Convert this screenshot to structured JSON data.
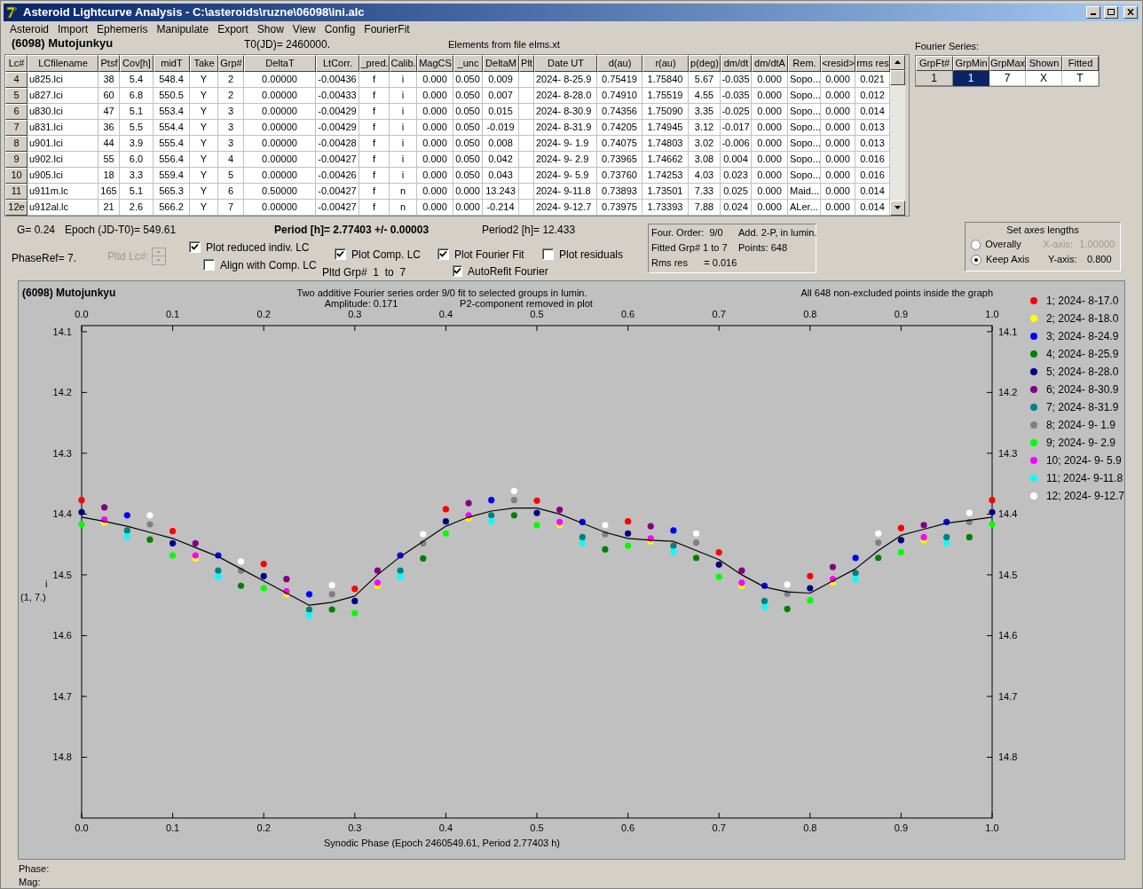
{
  "window": {
    "title": "Asteroid Lightcurve Analysis - C:\\asteroids\\ruzne\\06098\\ini.alc"
  },
  "menu": [
    "Asteroid",
    "Import",
    "Ephemeris",
    "Manipulate",
    "Export",
    "Show",
    "View",
    "Config",
    "FourierFit"
  ],
  "header": {
    "asteroid": "(6098) Mutojunkyu",
    "t0": "T0(JD)= 2460000.",
    "elements": "Elements from file elms.xt"
  },
  "table": {
    "columns": [
      "Lc#",
      "LCfilename",
      "Ptsf",
      "Cov[h]",
      "midT",
      "Take",
      "Grp#",
      "DeltaT",
      "LtCorr.",
      "_pred.",
      "Calib.",
      "MagCS",
      "_unc",
      "DeltaM",
      "Plt",
      "Date UT",
      "d(au)",
      "r(au)",
      "p(deg)",
      "dm/dt",
      "dm/dtA",
      "Rem.",
      "<resid>",
      "rms res"
    ],
    "rows": [
      {
        "cells": [
          "4",
          "u825.lci",
          "38",
          "5.4",
          "548.4",
          "Y",
          "2",
          "0.00000",
          "-0.00436",
          "f",
          "i",
          "0.000",
          "0.050",
          "0.009",
          "",
          "2024- 8-25.9",
          "0.75419",
          "1.75840",
          "5.67",
          "-0.035",
          "0.000",
          "Sopo...",
          "0.000",
          "0.021"
        ]
      },
      {
        "cells": [
          "5",
          "u827.lci",
          "60",
          "6.8",
          "550.5",
          "Y",
          "2",
          "0.00000",
          "-0.00433",
          "f",
          "i",
          "0.000",
          "0.050",
          "0.007",
          "",
          "2024- 8-28.0",
          "0.74910",
          "1.75519",
          "4.55",
          "-0.035",
          "0.000",
          "Sopo...",
          "0.000",
          "0.012"
        ]
      },
      {
        "cells": [
          "6",
          "u830.lci",
          "47",
          "5.1",
          "553.4",
          "Y",
          "3",
          "0.00000",
          "-0.00429",
          "f",
          "i",
          "0.000",
          "0.050",
          "0.015",
          "",
          "2024- 8-30.9",
          "0.74356",
          "1.75090",
          "3.35",
          "-0.025",
          "0.000",
          "Sopo...",
          "0.000",
          "0.014"
        ]
      },
      {
        "cells": [
          "7",
          "u831.lci",
          "36",
          "5.5",
          "554.4",
          "Y",
          "3",
          "0.00000",
          "-0.00429",
          "f",
          "i",
          "0.000",
          "0.050",
          "-0.019",
          "",
          "2024- 8-31.9",
          "0.74205",
          "1.74945",
          "3.12",
          "-0.017",
          "0.000",
          "Sopo...",
          "0.000",
          "0.013"
        ]
      },
      {
        "cells": [
          "8",
          "u901.lci",
          "44",
          "3.9",
          "555.4",
          "Y",
          "3",
          "0.00000",
          "-0.00428",
          "f",
          "i",
          "0.000",
          "0.050",
          "0.008",
          "",
          "2024- 9- 1.9",
          "0.74075",
          "1.74803",
          "3.02",
          "-0.006",
          "0.000",
          "Sopo...",
          "0.000",
          "0.013"
        ]
      },
      {
        "cells": [
          "9",
          "u902.lci",
          "55",
          "6.0",
          "556.4",
          "Y",
          "4",
          "0.00000",
          "-0.00427",
          "f",
          "i",
          "0.000",
          "0.050",
          "0.042",
          "",
          "2024- 9- 2.9",
          "0.73965",
          "1.74662",
          "3.08",
          "0.004",
          "0.000",
          "Sopo...",
          "0.000",
          "0.016"
        ]
      },
      {
        "cells": [
          "10",
          "u905.lci",
          "18",
          "3.3",
          "559.4",
          "Y",
          "5",
          "0.00000",
          "-0.00426",
          "f",
          "i",
          "0.000",
          "0.050",
          "0.043",
          "",
          "2024- 9- 5.9",
          "0.73760",
          "1.74253",
          "4.03",
          "0.023",
          "0.000",
          "Sopo...",
          "0.000",
          "0.016"
        ]
      },
      {
        "cells": [
          "11",
          "u911m.lc",
          "165",
          "5.1",
          "565.3",
          "Y",
          "6",
          "0.50000",
          "-0.00427",
          "f",
          "n",
          "0.000",
          "0.000",
          "13.243",
          "",
          "2024- 9-11.8",
          "0.73893",
          "1.73501",
          "7.33",
          "0.025",
          "0.000",
          "Maid...",
          "0.000",
          "0.014"
        ]
      },
      {
        "cells": [
          "12e",
          "u912al.lc",
          "21",
          "2.6",
          "566.2",
          "Y",
          "7",
          "0.00000",
          "-0.00427",
          "f",
          "n",
          "0.000",
          "0.000",
          "-0.214",
          "",
          "2024- 9-12.7",
          "0.73975",
          "1.73393",
          "7.88",
          "0.024",
          "0.000",
          "ALer...",
          "0.000",
          "0.014"
        ]
      }
    ]
  },
  "fourier": {
    "label": "Fourier Series:",
    "columns": [
      "GrpFt#",
      "GrpMin",
      "GrpMax",
      "Shown",
      "Fitted"
    ],
    "rows": [
      {
        "cells": [
          {
            "text": "1",
            "selected": false
          },
          {
            "text": "1",
            "selected": true
          },
          {
            "text": "7",
            "selected": false
          },
          {
            "text": "X",
            "selected": false
          },
          {
            "text": "T",
            "selected": false
          }
        ]
      }
    ]
  },
  "info": {
    "g": "G= 0.24",
    "epoch": "Epoch (JD-T0)= 549.61",
    "period": "Period [h]= 2.77403 +/- 0.00003",
    "period2": "Period2 [h]= 12.433",
    "phase_ref": "PhaseRef= 7.",
    "pltd_grp": "Pltd Grp#  1  to  7"
  },
  "spinner": {
    "label": "Pltd Lc#:",
    "disabled": true
  },
  "checkboxes": [
    {
      "label": "Plot reduced indiv. LC",
      "checked": true
    },
    {
      "label": "Align with Comp. LC",
      "checked": false
    },
    {
      "label": "Plot Comp. LC",
      "checked": true
    },
    {
      "label": "Plot Fourier Fit",
      "checked": true
    },
    {
      "label": "AutoRefit Fourier",
      "checked": true
    },
    {
      "label": "Plot residuals",
      "checked": false
    }
  ],
  "fit_box": [
    "Four. Order:  9/0",
    "Add. 2-P, in lumin.",
    "Fitted Grp# 1 to 7",
    "Points: 648",
    "Rms res      = 0.016"
  ],
  "axes": {
    "title": "Set axes lengths",
    "options": [
      {
        "label": "Overally",
        "selected": false
      },
      {
        "label": "Keep Axis",
        "selected": true
      }
    ],
    "fields": [
      {
        "label": "X-axis:",
        "value": "1.00000",
        "disabled": true
      },
      {
        "label": "Y-axis:",
        "value": "0.800",
        "disabled": false
      }
    ]
  },
  "plot": {
    "texts": {
      "title": "(6098) Mutojunkyu",
      "line1": "Two additive Fourier series order 9/0 fit to selected groups in lumin.",
      "amplitude": "Amplitude: 0.171",
      "p2": "P2-component removed in plot",
      "points": "All 648 non-excluded points inside the graph",
      "ylabel2": "(1, 7.)"
    },
    "chart_data": {
      "type": "scatter",
      "xlabel": "Synodic Phase (Epoch 2460549.61, Period 2.77403 h)",
      "ylabel": "i",
      "x": [
        0,
        0.025,
        0.05,
        0.075,
        0.1,
        0.125,
        0.15,
        0.175,
        0.2,
        0.225,
        0.25,
        0.275,
        0.3,
        0.325,
        0.35,
        0.375,
        0.4,
        0.425,
        0.45,
        0.475,
        0.5,
        0.525,
        0.55,
        0.575,
        0.6,
        0.625,
        0.65,
        0.675,
        0.7,
        0.725,
        0.75,
        0.775,
        0.8,
        0.825,
        0.85,
        0.875,
        0.9,
        0.925,
        0.95,
        0.975,
        1
      ],
      "series": [
        {
          "type": "line",
          "color": "#000000",
          "values": [
            14.405,
            14.412,
            14.42,
            14.43,
            14.44,
            14.455,
            14.47,
            14.49,
            14.51,
            14.53,
            14.55,
            14.545,
            14.535,
            14.5,
            14.47,
            14.445,
            14.42,
            14.405,
            14.395,
            14.39,
            14.39,
            14.4,
            14.415,
            14.43,
            14.44,
            14.443,
            14.445,
            14.46,
            14.475,
            14.5,
            14.52,
            14.528,
            14.53,
            14.51,
            14.49,
            14.46,
            14.435,
            14.425,
            14.415,
            14.41,
            14.405
          ]
        },
        {
          "name": "1; 2024- 8-17.0",
          "color": "#ff0000",
          "values": [
            14.377,
            null,
            null,
            null,
            14.428,
            null,
            null,
            null,
            14.482,
            null,
            null,
            null,
            14.523,
            null,
            null,
            null,
            14.392,
            null,
            null,
            null,
            14.378,
            null,
            null,
            null,
            14.412,
            null,
            null,
            null,
            14.463,
            null,
            null,
            null,
            14.502,
            null,
            null,
            null,
            14.423,
            null,
            null,
            null,
            14.377
          ]
        },
        {
          "name": "2; 2024- 8-18.0",
          "color": "#ffff00",
          "values": [
            null,
            14.414,
            null,
            null,
            null,
            14.473,
            null,
            null,
            null,
            14.532,
            null,
            null,
            null,
            14.518,
            null,
            null,
            null,
            14.407,
            null,
            null,
            null,
            14.418,
            null,
            null,
            null,
            14.445,
            null,
            null,
            null,
            14.518,
            null,
            null,
            null,
            14.512,
            null,
            null,
            null,
            14.443,
            null,
            null,
            null
          ]
        },
        {
          "name": "3; 2024- 8-24.9",
          "color": "#0000ff",
          "values": [
            null,
            null,
            14.402,
            null,
            null,
            null,
            14.468,
            null,
            null,
            null,
            14.532,
            null,
            null,
            null,
            14.468,
            null,
            null,
            null,
            14.377,
            null,
            null,
            null,
            14.413,
            null,
            null,
            null,
            14.427,
            null,
            null,
            null,
            14.518,
            null,
            null,
            null,
            14.472,
            null,
            null,
            null,
            14.413,
            null,
            null
          ]
        },
        {
          "name": "4; 2024- 8-25.9",
          "color": "#008000",
          "values": [
            null,
            null,
            null,
            14.442,
            null,
            null,
            null,
            14.518,
            null,
            null,
            null,
            14.557,
            null,
            null,
            null,
            14.473,
            null,
            null,
            null,
            14.402,
            null,
            null,
            null,
            14.458,
            null,
            null,
            null,
            14.472,
            null,
            null,
            null,
            14.556,
            null,
            null,
            null,
            14.472,
            null,
            null,
            null,
            14.438,
            null
          ]
        },
        {
          "name": "5; 2024- 8-28.0",
          "color": "#000080",
          "values": [
            14.397,
            null,
            null,
            null,
            14.448,
            null,
            null,
            null,
            14.502,
            null,
            null,
            null,
            14.543,
            null,
            null,
            null,
            14.412,
            null,
            null,
            null,
            14.398,
            null,
            null,
            null,
            14.432,
            null,
            null,
            null,
            14.483,
            null,
            null,
            null,
            14.522,
            null,
            null,
            null,
            14.443,
            null,
            null,
            null,
            14.397
          ]
        },
        {
          "name": "6; 2024- 8-30.9",
          "color": "#800080",
          "values": [
            null,
            14.389,
            null,
            null,
            null,
            14.448,
            null,
            null,
            null,
            14.507,
            null,
            null,
            null,
            14.493,
            null,
            null,
            null,
            14.382,
            null,
            null,
            null,
            14.393,
            null,
            null,
            null,
            14.42,
            null,
            null,
            null,
            14.493,
            null,
            null,
            null,
            14.487,
            null,
            null,
            null,
            14.418,
            null,
            null,
            null
          ]
        },
        {
          "name": "7; 2024- 8-31.9",
          "color": "#008080",
          "values": [
            null,
            null,
            14.427,
            null,
            null,
            null,
            14.493,
            null,
            null,
            null,
            14.557,
            null,
            null,
            null,
            14.493,
            null,
            null,
            null,
            14.402,
            null,
            null,
            null,
            14.438,
            null,
            null,
            null,
            14.452,
            null,
            null,
            null,
            14.543,
            null,
            null,
            null,
            14.497,
            null,
            null,
            null,
            14.438,
            null,
            null
          ]
        },
        {
          "name": "8; 2024- 9- 1.9",
          "color": "#808080",
          "values": [
            null,
            null,
            null,
            14.417,
            null,
            null,
            null,
            14.493,
            null,
            null,
            null,
            14.532,
            null,
            null,
            null,
            14.448,
            null,
            null,
            null,
            14.377,
            null,
            null,
            null,
            14.433,
            null,
            null,
            null,
            14.447,
            null,
            null,
            null,
            14.531,
            null,
            null,
            null,
            14.447,
            null,
            null,
            null,
            14.413,
            null
          ]
        },
        {
          "name": "9; 2024- 9- 2.9",
          "color": "#00ff00",
          "values": [
            14.417,
            null,
            null,
            null,
            14.468,
            null,
            null,
            null,
            14.522,
            null,
            null,
            null,
            14.563,
            null,
            null,
            null,
            14.432,
            null,
            null,
            null,
            14.418,
            null,
            null,
            null,
            14.452,
            null,
            null,
            null,
            14.503,
            null,
            null,
            null,
            14.542,
            null,
            null,
            null,
            14.463,
            null,
            null,
            null,
            14.417
          ]
        },
        {
          "name": "10; 2024- 9- 5.9",
          "color": "#ff00ff",
          "values": [
            null,
            14.409,
            null,
            null,
            null,
            14.468,
            null,
            null,
            null,
            14.527,
            null,
            null,
            null,
            14.513,
            null,
            null,
            null,
            14.402,
            null,
            null,
            null,
            14.413,
            null,
            null,
            null,
            14.44,
            null,
            null,
            null,
            14.513,
            null,
            null,
            null,
            14.507,
            null,
            null,
            null,
            14.438,
            null,
            null,
            null
          ]
        },
        {
          "name": "11; 2024- 9-11.8",
          "color": "#00ffff",
          "values": [
            null,
            null,
            14.437,
            null,
            null,
            null,
            14.503,
            null,
            null,
            null,
            14.567,
            null,
            null,
            null,
            14.503,
            null,
            null,
            null,
            14.412,
            null,
            null,
            null,
            14.448,
            null,
            null,
            null,
            14.462,
            null,
            null,
            null,
            14.553,
            null,
            null,
            null,
            14.507,
            null,
            null,
            null,
            14.448,
            null,
            null
          ]
        },
        {
          "name": "12; 2024- 9-12.7",
          "color": "#ffffff",
          "values": [
            null,
            null,
            null,
            14.402,
            null,
            null,
            null,
            14.478,
            null,
            null,
            null,
            14.517,
            null,
            null,
            null,
            14.433,
            null,
            null,
            null,
            14.362,
            null,
            null,
            null,
            14.418,
            null,
            null,
            null,
            14.432,
            null,
            null,
            null,
            14.516,
            null,
            null,
            null,
            14.432,
            null,
            null,
            null,
            14.398,
            null
          ]
        }
      ],
      "xlim": [
        0,
        1
      ],
      "ylim": [
        14.9,
        14.09
      ],
      "xticks": [
        {
          "value": 0,
          "label": "0.0"
        },
        {
          "value": 0.1,
          "label": "0.1"
        },
        {
          "value": 0.2,
          "label": "0.2"
        },
        {
          "value": 0.3,
          "label": "0.3"
        },
        {
          "value": 0.4,
          "label": "0.4"
        },
        {
          "value": 0.5,
          "label": "0.5"
        },
        {
          "value": 0.6,
          "label": "0.6"
        },
        {
          "value": 0.7,
          "label": "0.7"
        },
        {
          "value": 0.8,
          "label": "0.8"
        },
        {
          "value": 0.9,
          "label": "0.9"
        },
        {
          "value": 1,
          "label": "1.0"
        }
      ],
      "yticks": [
        {
          "value": 14.1,
          "label": "14.1"
        },
        {
          "value": 14.2,
          "label": "14.2"
        },
        {
          "value": 14.3,
          "label": "14.3"
        },
        {
          "value": 14.4,
          "label": "14.4"
        },
        {
          "value": 14.5,
          "label": "14.5"
        },
        {
          "value": 14.6,
          "label": "14.6"
        },
        {
          "value": 14.7,
          "label": "14.7"
        },
        {
          "value": 14.8,
          "label": "14.8"
        }
      ]
    }
  },
  "status": [
    "Phase:",
    "Mag:"
  ]
}
